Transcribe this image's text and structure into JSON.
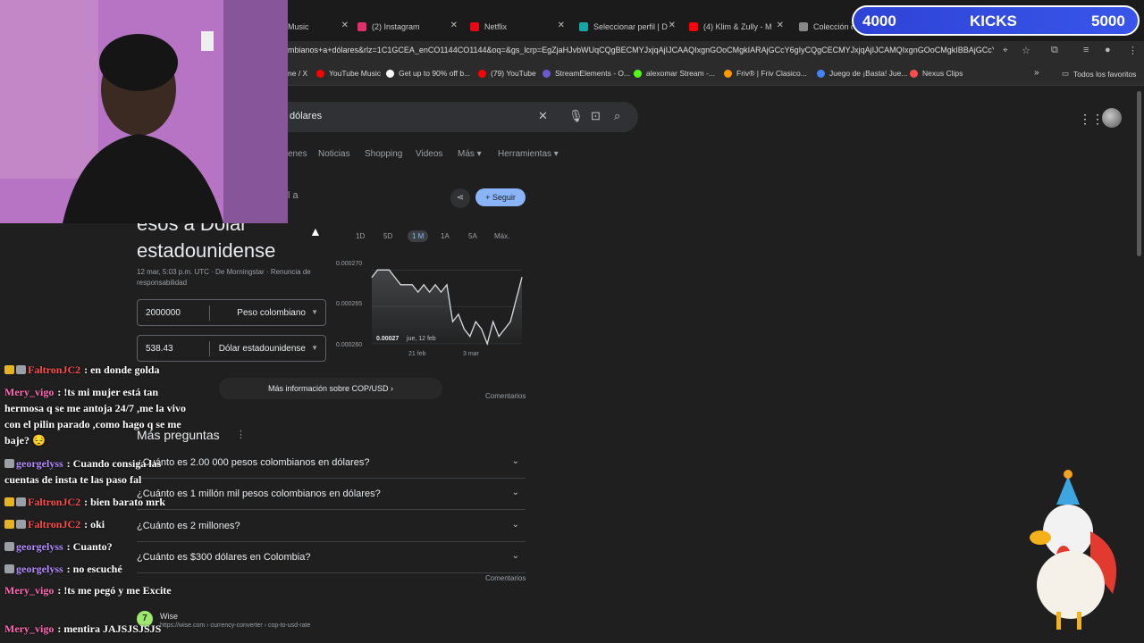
{
  "browser": {
    "tabs": [
      {
        "label": "Music",
        "color": "#ff0000"
      },
      {
        "label": "(2) Instagram",
        "color": "#e1306c"
      },
      {
        "label": "Netflix",
        "color": "#e50914"
      },
      {
        "label": "Seleccionar perfil | D",
        "color": "#16a6a6"
      },
      {
        "label": "(4) Klim & Zully - M",
        "color": "#ff0000"
      },
      {
        "label": "Colección de",
        "color": "#888888"
      }
    ],
    "url": "mbianos+a+dólares&rlz=1C1GCEA_enCO1144CO1144&oq=&gs_lcrp=EgZjaHJvbWUqCQgBECMYJxjqAjIJCAAQIxgnGOoCMgkIARAjGCcY6gIyCQgCECMYJxjqAjIJCAMQIxgnGOoCMgkIBBAjGCcY...",
    "bookmarks": [
      {
        "label": "ne / X",
        "color": "#dddddd"
      },
      {
        "label": "YouTube Music",
        "color": "#ff0000"
      },
      {
        "label": "Get up to 90% off b...",
        "color": "#ffffff"
      },
      {
        "label": "(79) YouTube",
        "color": "#ff0000"
      },
      {
        "label": "StreamElements - O...",
        "color": "#6a5acd"
      },
      {
        "label": "alexomar Stream -...",
        "color": "#53fc18"
      },
      {
        "label": "Friv® | Friv Clasico...",
        "color": "#ff9900"
      },
      {
        "label": "Juego de ¡Basta! Jue...",
        "color": "#4285f4"
      },
      {
        "label": "Nexus Clips",
        "color": "#ff4d4d"
      }
    ],
    "all_bookmarks": "Todos los favoritos"
  },
  "search": {
    "query": "dólares",
    "tabs": [
      "enes",
      "Noticias",
      "Shopping",
      "Videos",
      "Más",
      "Herramientas"
    ]
  },
  "converter": {
    "partial_heading": "l a",
    "title_line1": "ésos a Dólar",
    "title_line2": "estadounidense",
    "meta": "12 mar, 5:03 p.m. UTC · De Morningstar · Renuncia de responsabilidad",
    "from_amount": "2000000",
    "from_currency": "Peso colombiano",
    "to_amount": "538.43",
    "to_currency": "Dólar estadounidense",
    "follow_label": "Seguir",
    "ranges": [
      "1D",
      "5D",
      "1 M",
      "1A",
      "5A",
      "Máx."
    ],
    "active_range": "1 M",
    "more_info": "Más información sobre COP/USD",
    "feedback": "Comentarios"
  },
  "chart_data": {
    "type": "line",
    "y_ticks": [
      "0.000270",
      "0.000265",
      "0.000260"
    ],
    "x_ticks": [
      "21 feb",
      "3 mar"
    ],
    "ylim": [
      0.00026,
      0.000271
    ],
    "values": [
      0.000269,
      0.00027,
      0.00027,
      0.00027,
      0.000269,
      0.000268,
      0.000268,
      0.000268,
      0.000267,
      0.000268,
      0.000267,
      0.000268,
      0.000267,
      0.000268,
      0.000263,
      0.000264,
      0.000262,
      0.000261,
      0.000263,
      0.000262,
      0.00026,
      0.000263,
      0.000261,
      0.000262,
      0.000263,
      0.000266,
      0.000269
    ],
    "tooltip_value": "0.00027",
    "tooltip_date": "jue, 12 feb",
    "line_color": "#dadce0"
  },
  "faq": {
    "title": "Más preguntas",
    "items": [
      "¿Cuánto es 2.00 000 pesos colombianos en dólares?",
      "¿Cuánto es 1 millón mil pesos colombianos en dólares?",
      "¿Cuánto es 2 millones?",
      "¿Cuánto es $300 dólares en Colombia?"
    ],
    "feedback": "Comentarios"
  },
  "result": {
    "site": "Wise",
    "url": "https://wise.com › currency-converter › cop-to-usd-rate"
  },
  "stream": {
    "kicks_current": "4000",
    "kicks_label": "KICKS",
    "kicks_goal": "5000",
    "kicks_progress": 0.8,
    "chat": [
      {
        "user": "FaltronJC2",
        "color": "#ff4d4d",
        "badges": [
          "crown",
          "sub"
        ],
        "text": "en donde golda"
      },
      {
        "user": "Mery_vigo",
        "color": "#ff69b4",
        "badges": [],
        "text": "!ts mi mujer está tan hermosa q se me antoja 24/7 ,me la vivo con el pilin parado ,como hago q se me baje? 😔"
      },
      {
        "user": "georgelyss",
        "color": "#b48cff",
        "badges": [
          "sub"
        ],
        "text": "Cuando consiga las cuentas de insta te las paso fal"
      },
      {
        "user": "FaltronJC2",
        "color": "#ff4d4d",
        "badges": [
          "crown",
          "sub"
        ],
        "text": "bien barato mrk"
      },
      {
        "user": "FaltronJC2",
        "color": "#ff4d4d",
        "badges": [
          "crown",
          "sub"
        ],
        "text": "oki"
      },
      {
        "user": "georgelyss",
        "color": "#b48cff",
        "badges": [
          "sub"
        ],
        "text": "Cuanto?"
      },
      {
        "user": "georgelyss",
        "color": "#b48cff",
        "badges": [
          "sub"
        ],
        "text": "no escuché"
      },
      {
        "user": "Mery_vigo",
        "color": "#ff69b4",
        "badges": [],
        "text": "!ts me pegó y me Excite"
      },
      {
        "user": "Mery_vigo",
        "color": "#ff69b4",
        "badges": [],
        "text": "mentira JAJSJSJSJS"
      }
    ]
  }
}
